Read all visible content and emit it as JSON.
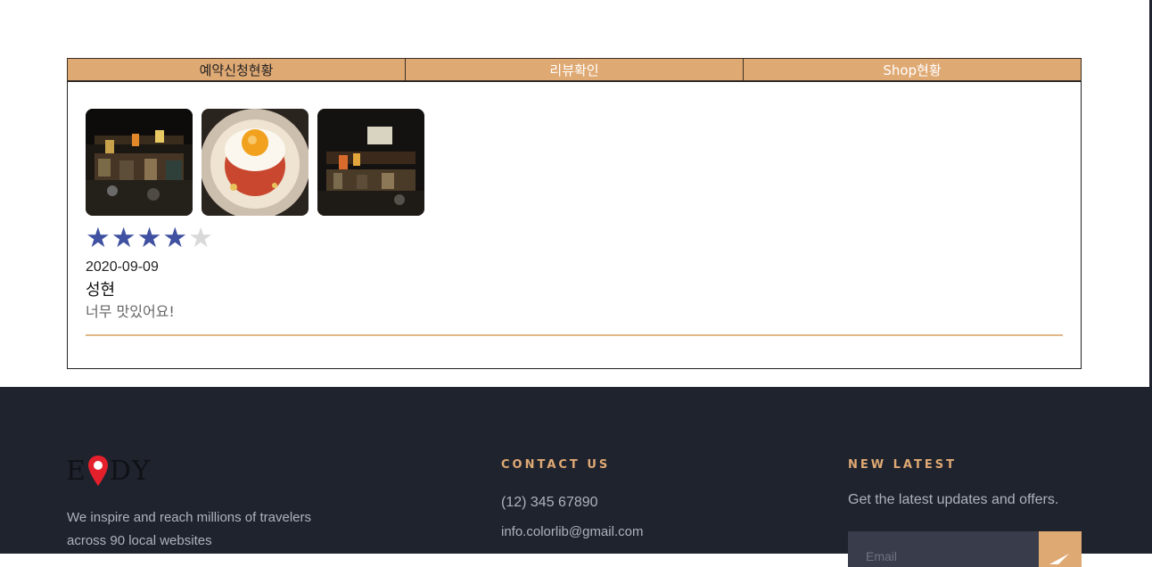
{
  "tabs": [
    {
      "label": "예약신청현황"
    },
    {
      "label": "리뷰확인"
    },
    {
      "label": "Shop현황"
    }
  ],
  "review": {
    "photos": [
      {
        "icon": "restaurant-interior-photo"
      },
      {
        "icon": "fried-egg-dish-photo"
      },
      {
        "icon": "restaurant-interior-photo"
      }
    ],
    "rating": 4,
    "rating_max": 5,
    "star_on_color": "#3f51a0",
    "star_off_color": "#d9d9d9",
    "date": "2020-09-09",
    "author": "성현",
    "comment": "너무 맛있어요!"
  },
  "footer": {
    "logo_text_left": "E",
    "logo_text_right": "DY",
    "logo_icon": "map-pin-icon",
    "about_line1": "We inspire and reach millions of travelers",
    "about_line2": "across 90 local websites",
    "contact_heading": "CONTACT US",
    "phone": "(12) 345 67890",
    "email": "info.colorlib@gmail.com",
    "latest_heading": "NEW LATEST",
    "latest_text": "Get the latest updates and offers.",
    "email_placeholder": "Email",
    "send_icon": "send-icon"
  },
  "colors": {
    "accent": "#dfa974",
    "footer_bg": "#1f232d"
  }
}
